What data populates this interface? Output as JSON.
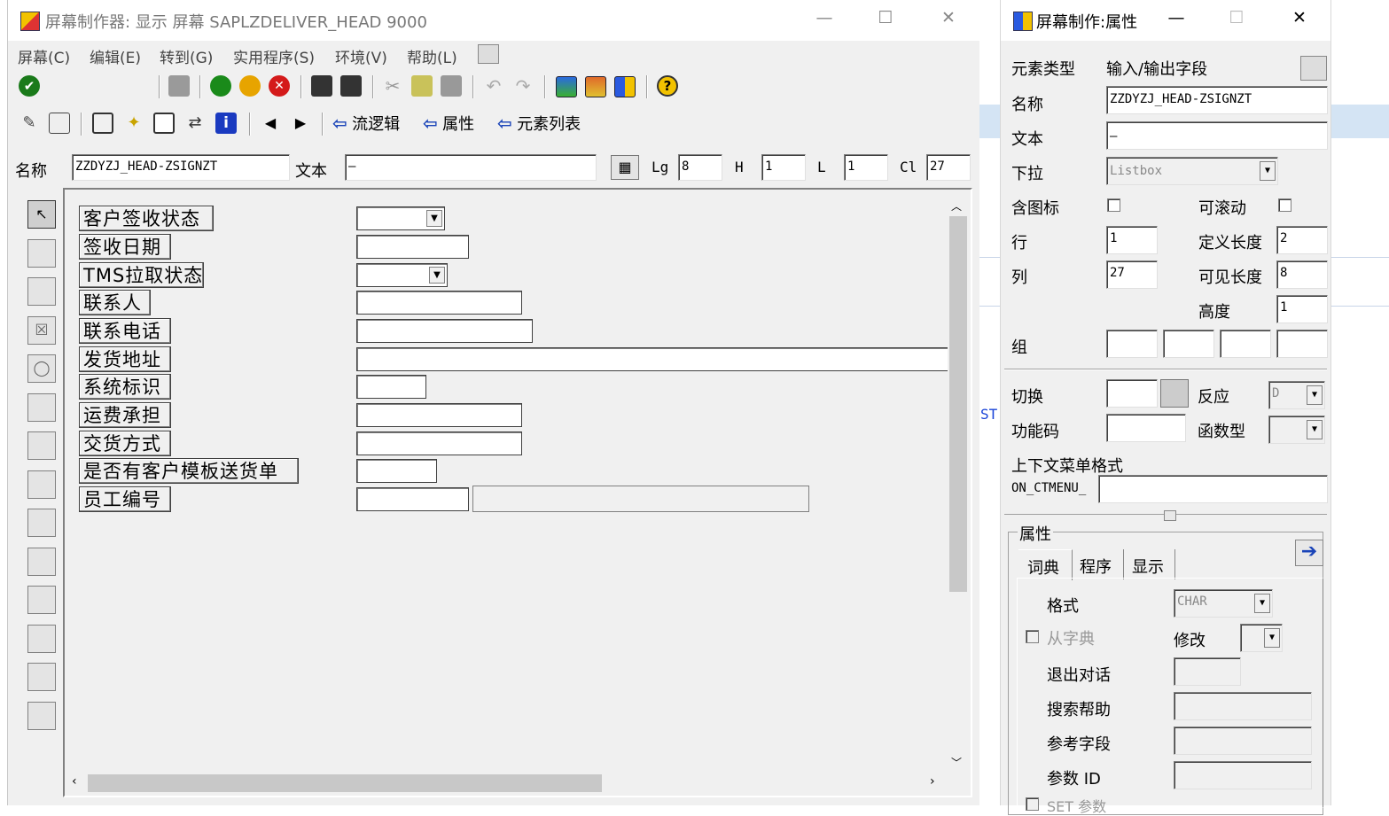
{
  "main": {
    "title": "屏幕制作器:  显示 屏幕 SAPLZDELIVER_HEAD 9000",
    "menu": [
      "屏幕(C)",
      "编辑(E)",
      "转到(G)",
      "实用程序(S)",
      "环境(V)",
      "帮助(L)"
    ],
    "toolbar2": {
      "flow": "流逻辑",
      "attrs": "属性",
      "elements": "元素列表"
    },
    "fieldbar": {
      "name_label": "名称",
      "name_value": "ZZDYZJ_HEAD-ZSIGNZT",
      "text_label": "文本",
      "text_value": "—",
      "lg_label": "Lg",
      "lg_value": "8",
      "h_label": "H",
      "h_value": "1",
      "l_label": "L",
      "l_value": "1",
      "cl_label": "Cl",
      "cl_value": "27"
    },
    "rows": [
      "客户签收状态",
      "签收日期",
      "TMS拉取状态",
      "联系人",
      "联系电话",
      "发货地址",
      "系统标识",
      "运费承担",
      "交货方式",
      "是否有客户模板送货单",
      "员工编号"
    ]
  },
  "props": {
    "title": "屏幕制作:属性",
    "elem_type_label": "元素类型",
    "elem_type_value": "输入/输出字段",
    "name_label": "名称",
    "name_value": "ZZDYZJ_HEAD-ZSIGNZT",
    "text_label": "文本",
    "text_value": "—",
    "dropdown_label": "下拉",
    "dropdown_value": "Listbox",
    "icon_label": "含图标",
    "scroll_label": "可滚动",
    "row_label": "行",
    "row_value": "1",
    "deflen_label": "定义长度",
    "deflen_value": "2",
    "col_label": "列",
    "col_value": "27",
    "vislen_label": "可见长度",
    "vislen_value": "8",
    "height_label": "高度",
    "height_value": "1",
    "group_label": "组",
    "switch_label": "切换",
    "react_label": "反应",
    "react_value": "D",
    "fcode_label": "功能码",
    "functype_label": "函数型",
    "ctx_label": "上下文菜单格式",
    "ctx_prefix": "ON_CTMENU_",
    "attr_group": "属性",
    "tabs": [
      "词典",
      "程序",
      "显示"
    ],
    "format_label": "格式",
    "format_value": "CHAR",
    "from_dict_label": "从字典",
    "modify_label": "修改",
    "exit_label": "退出对话",
    "search_label": "搜索帮助",
    "ref_label": "参考字段",
    "param_label": "参数 ID",
    "setparam_label": "SET 参数"
  },
  "bg": {
    "fragment": "ST"
  }
}
